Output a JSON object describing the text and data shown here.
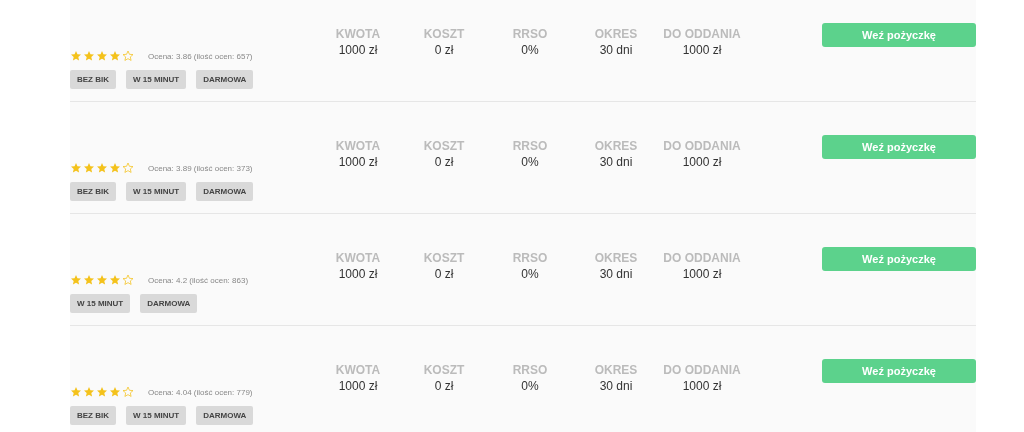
{
  "offers": [
    {
      "stars": 4,
      "rating": "Ocena: 3.86 (ilość ocen: 657)",
      "tags": [
        "BEZ BIK",
        "W 15 MINUT",
        "DARMOWA"
      ],
      "stats": [
        {
          "label": "KWOTA",
          "value": "1000 zł"
        },
        {
          "label": "KOSZT",
          "value": "0 zł"
        },
        {
          "label": "RRSO",
          "value": "0%"
        },
        {
          "label": "OKRES",
          "value": "30 dni"
        },
        {
          "label": "DO ODDANIA",
          "value": "1000 zł"
        }
      ],
      "button": "Weź pożyczkę"
    },
    {
      "stars": 4,
      "rating": "Ocena: 3.89 (ilość ocen: 373)",
      "tags": [
        "BEZ BIK",
        "W 15 MINUT",
        "DARMOWA"
      ],
      "stats": [
        {
          "label": "KWOTA",
          "value": "1000 zł"
        },
        {
          "label": "KOSZT",
          "value": "0 zł"
        },
        {
          "label": "RRSO",
          "value": "0%"
        },
        {
          "label": "OKRES",
          "value": "30 dni"
        },
        {
          "label": "DO ODDANIA",
          "value": "1000 zł"
        }
      ],
      "button": "Weź pożyczkę"
    },
    {
      "stars": 4,
      "rating": "Ocena: 4.2 (ilość ocen: 863)",
      "tags": [
        "W 15 MINUT",
        "DARMOWA"
      ],
      "stats": [
        {
          "label": "KWOTA",
          "value": "1000 zł"
        },
        {
          "label": "KOSZT",
          "value": "0 zł"
        },
        {
          "label": "RRSO",
          "value": "0%"
        },
        {
          "label": "OKRES",
          "value": "30 dni"
        },
        {
          "label": "DO ODDANIA",
          "value": "1000 zł"
        }
      ],
      "button": "Weź pożyczkę"
    },
    {
      "stars": 4,
      "rating": "Ocena: 4.04 (ilość ocen: 779)",
      "tags": [
        "BEZ BIK",
        "W 15 MINUT",
        "DARMOWA"
      ],
      "stats": [
        {
          "label": "KWOTA",
          "value": "1000 zł"
        },
        {
          "label": "KOSZT",
          "value": "0 zł"
        },
        {
          "label": "RRSO",
          "value": "0%"
        },
        {
          "label": "OKRES",
          "value": "30 dni"
        },
        {
          "label": "DO ODDANIA",
          "value": "1000 zł"
        }
      ],
      "button": "Weź pożyczkę"
    }
  ]
}
